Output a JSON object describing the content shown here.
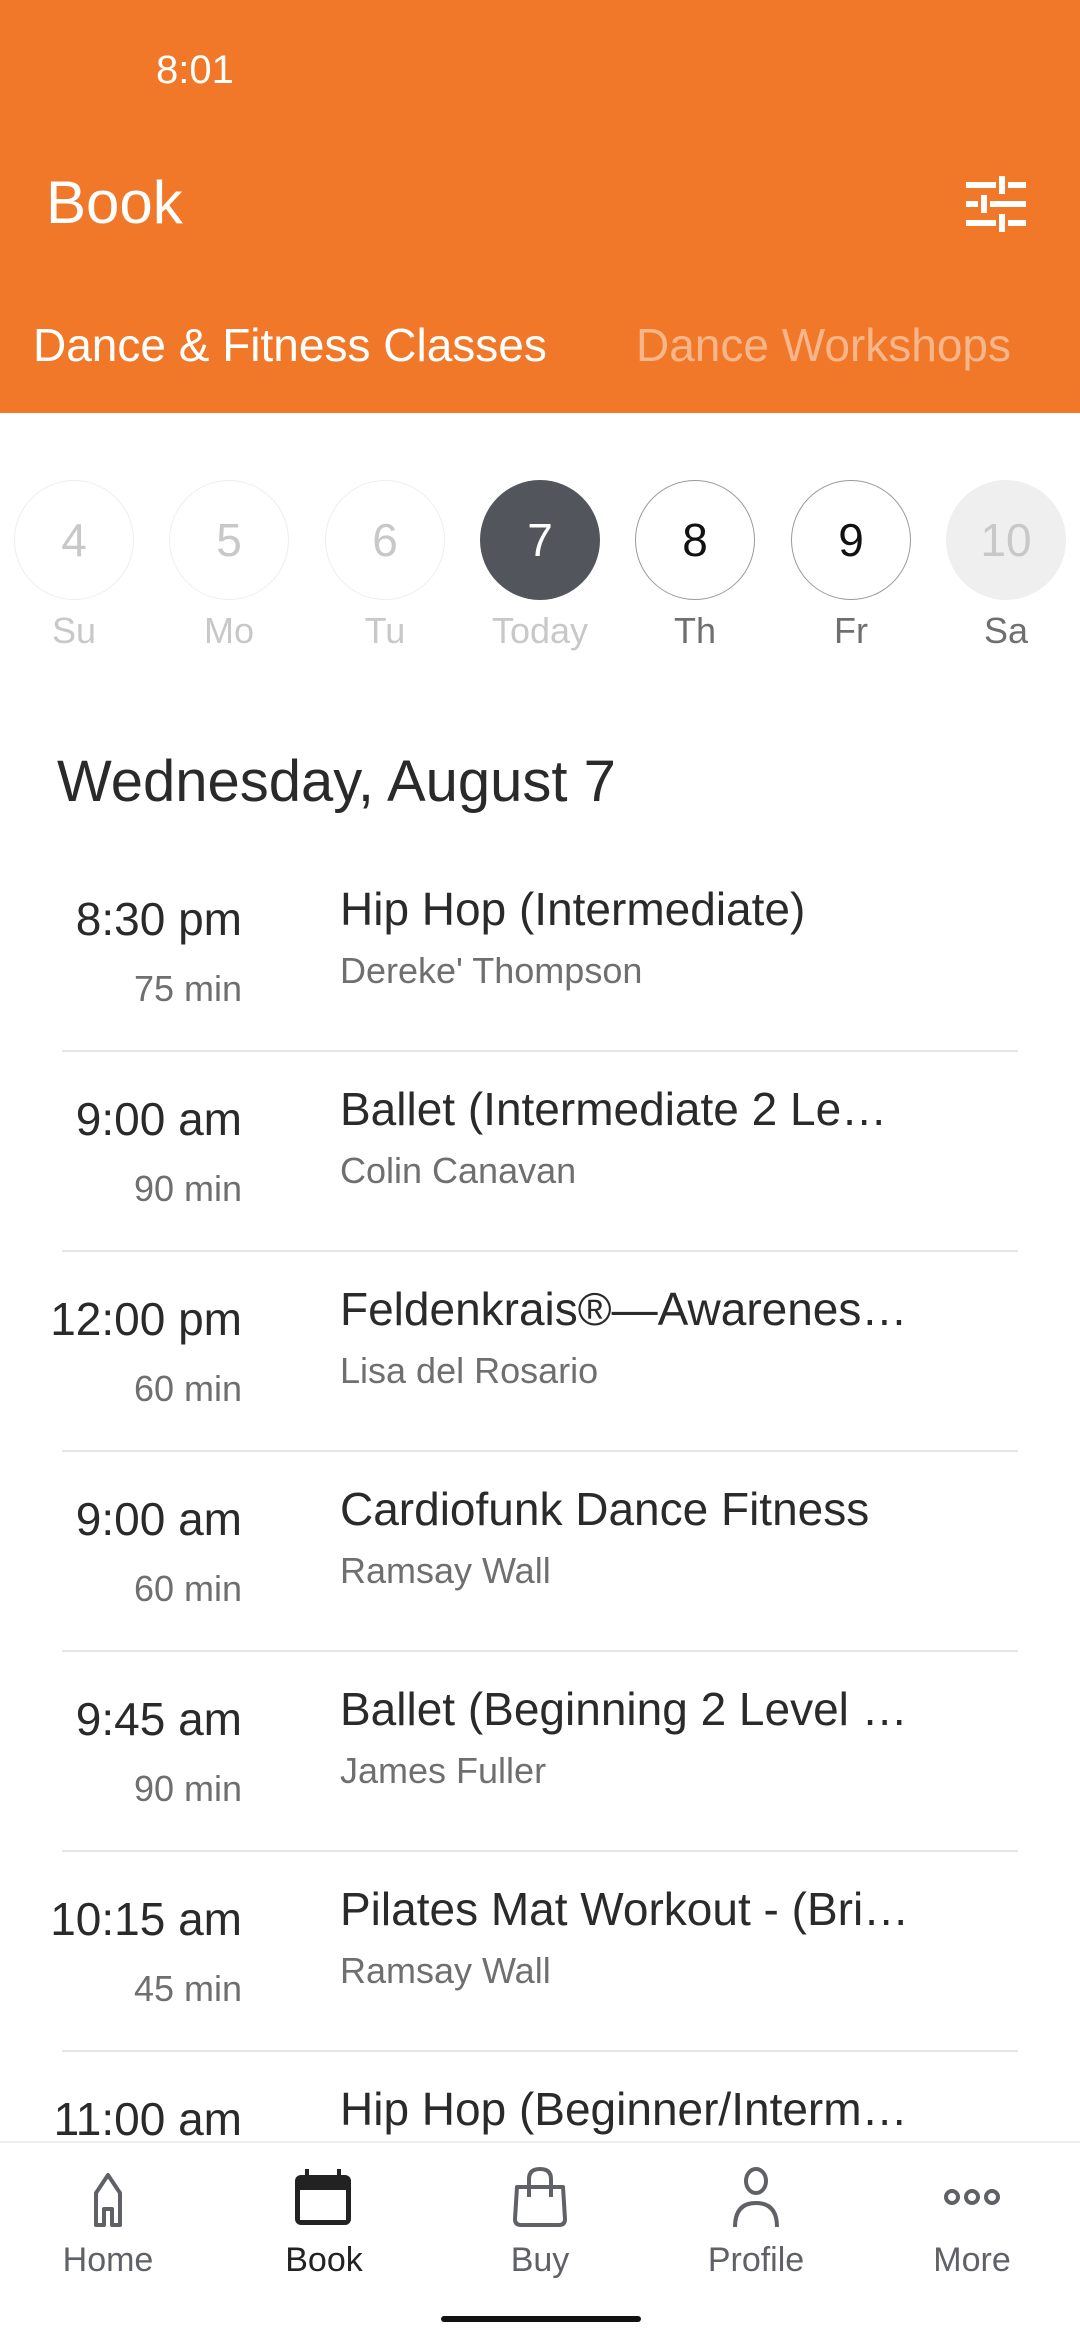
{
  "status_bar": {
    "time": "8:01"
  },
  "header": {
    "title": "Book",
    "filter_icon": "sliders-icon",
    "tabs": [
      {
        "label": "Dance & Fitness Classes",
        "active": true
      },
      {
        "label": "Dance Workshops",
        "active": false
      }
    ]
  },
  "date_picker": {
    "days": [
      {
        "num": "4",
        "label": "Su",
        "state": "past"
      },
      {
        "num": "5",
        "label": "Mo",
        "state": "past"
      },
      {
        "num": "6",
        "label": "Tu",
        "state": "past"
      },
      {
        "num": "7",
        "label": "Today",
        "state": "selected"
      },
      {
        "num": "8",
        "label": "Th",
        "state": "available"
      },
      {
        "num": "9",
        "label": "Fr",
        "state": "available"
      },
      {
        "num": "10",
        "label": "Sa",
        "state": "unavailable"
      }
    ]
  },
  "schedule": {
    "date_title": "Wednesday, August 7",
    "classes": [
      {
        "time": "8:30 pm",
        "duration": "75 min",
        "name": "Hip Hop (Intermediate)",
        "teacher": "Dereke' Thompson"
      },
      {
        "time": "9:00 am",
        "duration": "90 min",
        "name": "Ballet (Intermediate 2 Le…",
        "teacher": "Colin Canavan"
      },
      {
        "time": "12:00 pm",
        "duration": "60 min",
        "name": "Feldenkrais®—Awarenes…",
        "teacher": "Lisa del Rosario"
      },
      {
        "time": "9:00 am",
        "duration": "60 min",
        "name": "Cardiofunk Dance Fitness",
        "teacher": "Ramsay Wall"
      },
      {
        "time": "9:45 am",
        "duration": "90 min",
        "name": "Ballet (Beginning 2 Level …",
        "teacher": "James Fuller"
      },
      {
        "time": "10:15 am",
        "duration": "45 min",
        "name": "Pilates Mat Workout - (Bri…",
        "teacher": "Ramsay Wall"
      },
      {
        "time": "11:00 am",
        "duration": "",
        "name": "Hip Hop (Beginner/Interm…",
        "teacher": ""
      }
    ]
  },
  "bottom_nav": {
    "items": [
      {
        "label": "Home",
        "icon": "home-icon",
        "active": false
      },
      {
        "label": "Book",
        "icon": "calendar-icon",
        "active": true
      },
      {
        "label": "Buy",
        "icon": "shopping-bag-icon",
        "active": false
      },
      {
        "label": "Profile",
        "icon": "person-icon",
        "active": false
      },
      {
        "label": "More",
        "icon": "more-dots-icon",
        "active": false
      }
    ]
  },
  "colors": {
    "brand": "#F07828",
    "selected_day": "#52555C"
  }
}
